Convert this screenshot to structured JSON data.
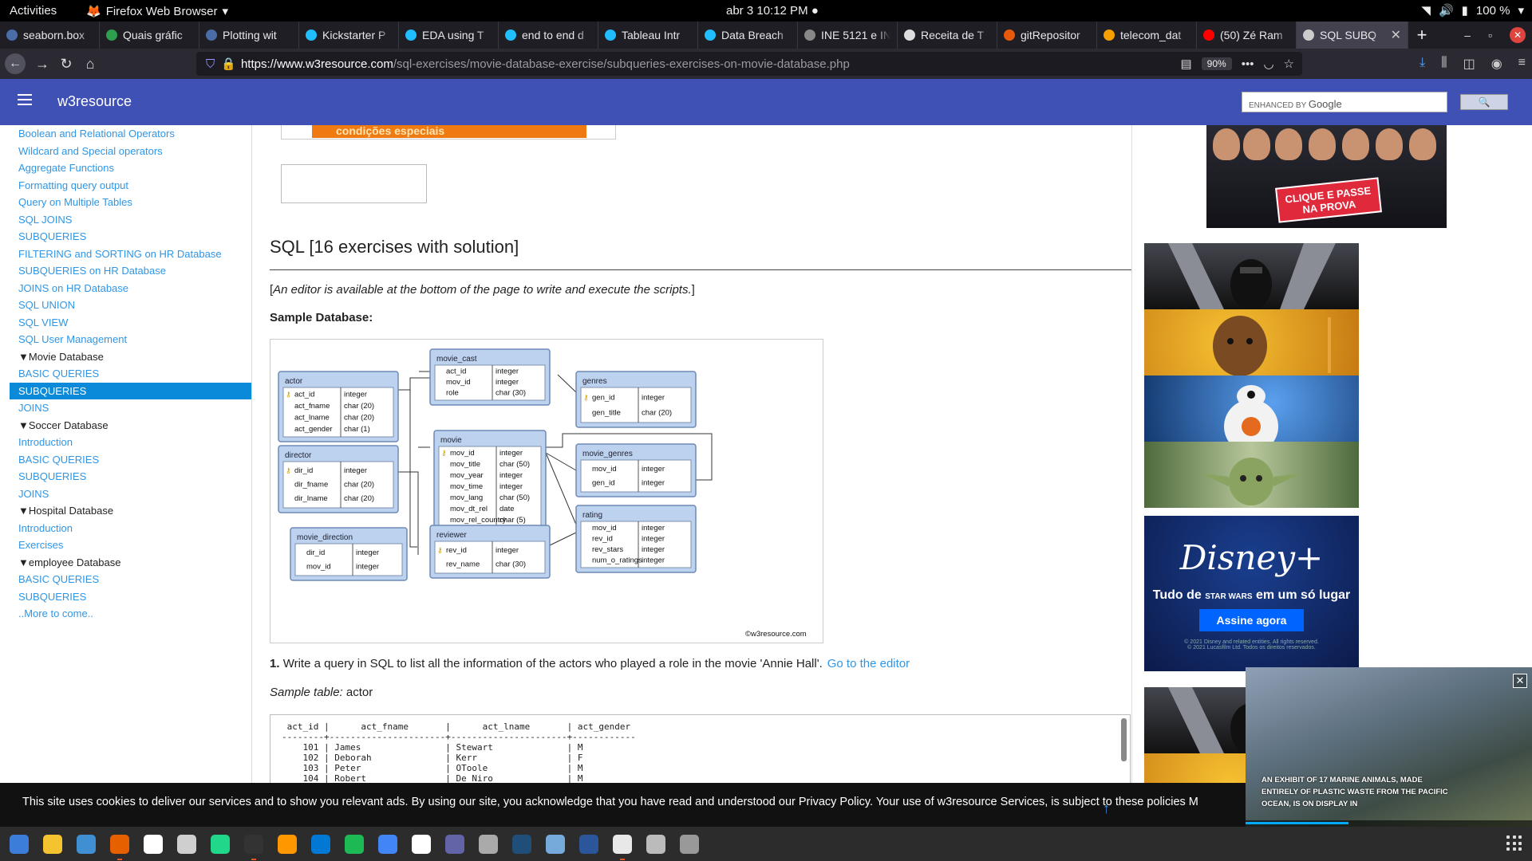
{
  "system_bar": {
    "activities": "Activities",
    "app_name": "Firefox Web Browser",
    "clock": "abr 3  10:12 PM",
    "battery": "100 %"
  },
  "tabs": [
    {
      "title": "seaborn.box",
      "color": "#4a6da7"
    },
    {
      "title": "Quais gráfic",
      "color": "#2e9e4f"
    },
    {
      "title": "Plotting wit",
      "color": "#4a6da7"
    },
    {
      "title": "Kickstarter P",
      "color": "#20beff"
    },
    {
      "title": "EDA using T",
      "color": "#20beff"
    },
    {
      "title": "end to end d",
      "color": "#20beff"
    },
    {
      "title": "Tableau Intr",
      "color": "#20beff"
    },
    {
      "title": "Data Breach",
      "color": "#20beff"
    },
    {
      "title": "INE 5121 e INE",
      "color": "#888888"
    },
    {
      "title": "Receita de T",
      "color": "#dddddd"
    },
    {
      "title": "gitRepositor",
      "color": "#e8590c"
    },
    {
      "title": "telecom_dat",
      "color": "#f59f00"
    },
    {
      "title": "(50) Zé Ram",
      "color": "#ff0000"
    },
    {
      "title": "SQL SUBQ",
      "color": "#cccccc",
      "active": true
    }
  ],
  "url": {
    "host": "https://www.w3resource.com",
    "path": "/sql-exercises/movie-database-exercise/subqueries-exercises-on-movie-database.php",
    "zoom": "90%"
  },
  "site": {
    "brand": "w3resource",
    "search_placeholder_prefix": "ENHANCED BY",
    "search_placeholder_brand": "Google"
  },
  "sidebar": [
    {
      "label": "Boolean and Relational Operators"
    },
    {
      "label": "Wildcard and Special operators"
    },
    {
      "label": "Aggregate Functions"
    },
    {
      "label": "Formatting query output"
    },
    {
      "label": "Query on Multiple Tables"
    },
    {
      "label": "SQL JOINS"
    },
    {
      "label": "SUBQUERIES"
    },
    {
      "label": "FILTERING and SORTING on HR Database"
    },
    {
      "label": "SUBQUERIES on HR Database"
    },
    {
      "label": "JOINS on HR Database"
    },
    {
      "label": "SQL UNION"
    },
    {
      "label": "SQL VIEW"
    },
    {
      "label": "SQL User Management"
    },
    {
      "label": "▼Movie Database",
      "header": true
    },
    {
      "label": "BASIC QUERIES"
    },
    {
      "label": "SUBQUERIES",
      "selected": true
    },
    {
      "label": "JOINS"
    },
    {
      "label": "▼Soccer Database",
      "header": true
    },
    {
      "label": "Introduction"
    },
    {
      "label": "BASIC QUERIES"
    },
    {
      "label": "SUBQUERIES"
    },
    {
      "label": "JOINS"
    },
    {
      "label": "▼Hospital Database",
      "header": true
    },
    {
      "label": "Introduction"
    },
    {
      "label": "Exercises"
    },
    {
      "label": "▼employee Database",
      "header": true
    },
    {
      "label": "BASIC QUERIES"
    },
    {
      "label": "SUBQUERIES"
    },
    {
      "label": "..More to come.."
    }
  ],
  "main": {
    "ad_text": "condições especiais",
    "heading": "SQL [16 exercises with solution]",
    "editor_note_italic": "An editor is available at the bottom of the page to write and execute the scripts.",
    "sample_db_label": "Sample Database:",
    "question_number": "1.",
    "question_text": "Write a query in SQL to list all the information of the actors who played a role in the movie 'Annie Hall'.",
    "editor_link": "Go to the editor",
    "sample_table_label": "Sample table:",
    "sample_table_name": "actor",
    "code": " act_id |      act_fname       |      act_lname       | act_gender\n--------+----------------------+----------------------+------------\n    101 | James                | Stewart              | M\n    102 | Deborah              | Kerr                 | F\n    103 | Peter                | OToole               | M\n    104 | Robert               | De Niro              | M"
  },
  "diagram": {
    "copyright": "©w3resource.com",
    "tables": [
      {
        "name": "actor",
        "cols": [
          [
            "act_id",
            "integer",
            true
          ],
          [
            "act_fname",
            "char (20)"
          ],
          [
            "act_lname",
            "char (20)"
          ],
          [
            "act_gender",
            "char (1)"
          ]
        ]
      },
      {
        "name": "movie_cast",
        "cols": [
          [
            "act_id",
            "integer"
          ],
          [
            "mov_id",
            "integer"
          ],
          [
            "role",
            "char (30)"
          ]
        ]
      },
      {
        "name": "genres",
        "cols": [
          [
            "gen_id",
            "integer",
            true
          ],
          [
            "gen_title",
            "char (20)"
          ]
        ]
      },
      {
        "name": "director",
        "cols": [
          [
            "dir_id",
            "integer",
            true
          ],
          [
            "dir_fname",
            "char (20)"
          ],
          [
            "dir_lname",
            "char (20)"
          ]
        ]
      },
      {
        "name": "movie",
        "cols": [
          [
            "mov_id",
            "integer",
            true
          ],
          [
            "mov_title",
            "char (50)"
          ],
          [
            "mov_year",
            "integer"
          ],
          [
            "mov_time",
            "integer"
          ],
          [
            "mov_lang",
            "char (50)"
          ],
          [
            "mov_dt_rel",
            "date"
          ],
          [
            "mov_rel_country",
            "char (5)"
          ]
        ]
      },
      {
        "name": "movie_genres",
        "cols": [
          [
            "mov_id",
            "integer"
          ],
          [
            "gen_id",
            "integer"
          ]
        ]
      },
      {
        "name": "movie_direction",
        "cols": [
          [
            "dir_id",
            "integer"
          ],
          [
            "mov_id",
            "integer"
          ]
        ]
      },
      {
        "name": "reviewer",
        "cols": [
          [
            "rev_id",
            "integer",
            true
          ],
          [
            "rev_name",
            "char (30)"
          ]
        ]
      },
      {
        "name": "rating",
        "cols": [
          [
            "mov_id",
            "integer"
          ],
          [
            "rev_id",
            "integer"
          ],
          [
            "rev_stars",
            "integer"
          ],
          [
            "num_o_ratings",
            "integer"
          ]
        ]
      }
    ]
  },
  "ads": {
    "people_cta": "CLIQUE E PASSE NA PROVA",
    "disney_logo": "Disney+",
    "disney_tag_prefix": "Tudo de",
    "disney_tag_brand": "STAR WARS",
    "disney_tag_suffix": "em um só lugar",
    "disney_button": "Assine agora",
    "disney_fine1": "© 2021 Disney and related entities. All rights reserved.",
    "disney_fine2": "© 2021 Lucasfilm Ltd. Todos os direitos reservados.",
    "video_caption": "AN EXHIBIT OF 17 MARINE ANIMALS, MADE ENTIRELY OF PLASTIC WASTE FROM THE PACIFIC OCEAN, IS ON DISPLAY IN"
  },
  "cookie": {
    "text": "This site uses cookies to deliver our services and to show you relevant ads. By using our site, you acknowledge that you have read and understood our Privacy Policy. Your use of w3resource Services, is subject to these policies M"
  },
  "dock": [
    {
      "icon": "system-icon",
      "color": "#3b7dd8"
    },
    {
      "icon": "settings-icon",
      "color": "#f4c430"
    },
    {
      "icon": "help-icon",
      "color": "#3f8fd2"
    },
    {
      "icon": "firefox-icon",
      "color": "#e66000",
      "running": true
    },
    {
      "icon": "opera-icon",
      "color": "#ffffff"
    },
    {
      "icon": "files-icon",
      "color": "#cfcfcf"
    },
    {
      "icon": "pycharm-icon",
      "color": "#21d789"
    },
    {
      "icon": "terminal-icon",
      "color": "#333333",
      "running": true
    },
    {
      "icon": "sublime-icon",
      "color": "#ff9800"
    },
    {
      "icon": "vscode-icon",
      "color": "#0078d4"
    },
    {
      "icon": "spotify-icon",
      "color": "#1db954"
    },
    {
      "icon": "docs-icon",
      "color": "#4285f4"
    },
    {
      "icon": "notes-icon",
      "color": "#ffffff"
    },
    {
      "icon": "teams-icon",
      "color": "#6264a7"
    },
    {
      "icon": "printer-icon",
      "color": "#aaaaaa"
    },
    {
      "icon": "tableau-icon",
      "color": "#1f4e79"
    },
    {
      "icon": "r-icon",
      "color": "#75aadb"
    },
    {
      "icon": "word-icon",
      "color": "#2b579a"
    },
    {
      "icon": "presentation-icon",
      "color": "#e8e8e8",
      "running": true
    },
    {
      "icon": "device-icon",
      "color": "#bbbbbb"
    },
    {
      "icon": "disk-icon",
      "color": "#999999"
    }
  ]
}
